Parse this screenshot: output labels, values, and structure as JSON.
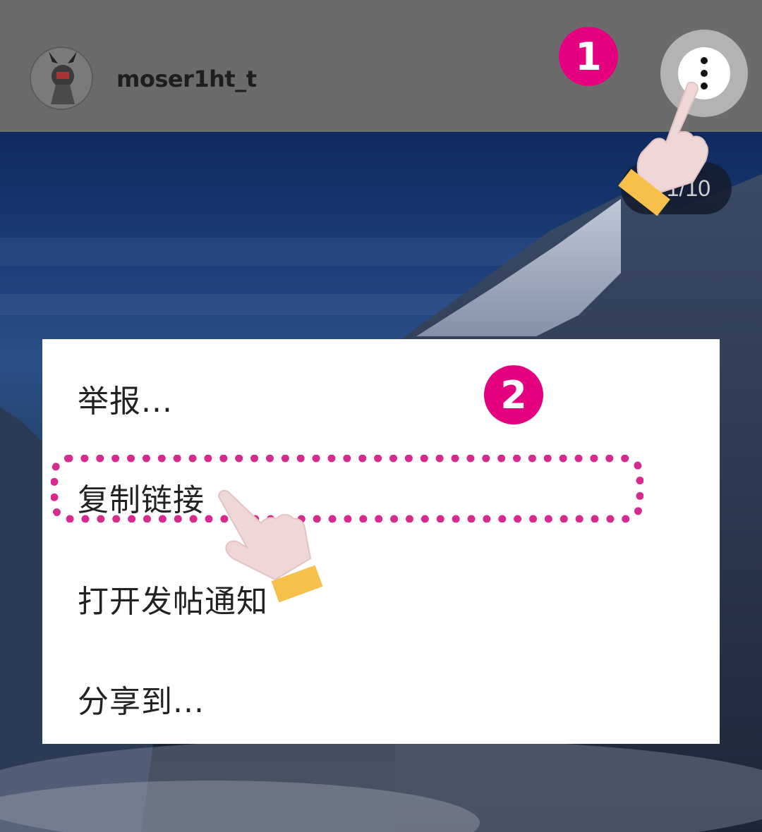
{
  "header": {
    "username": "moser1ht_t",
    "more_button_icon": "more-vertical-icon"
  },
  "media": {
    "counter": "1/10"
  },
  "menu": {
    "items": [
      {
        "label": "举报..."
      },
      {
        "label": "复制链接"
      },
      {
        "label": "打开发帖通知"
      },
      {
        "label": "分享到..."
      }
    ]
  },
  "annotations": {
    "step1": "1",
    "step2": "2",
    "badge_color": "#e5007f",
    "highlight_color": "#d62a8e"
  }
}
